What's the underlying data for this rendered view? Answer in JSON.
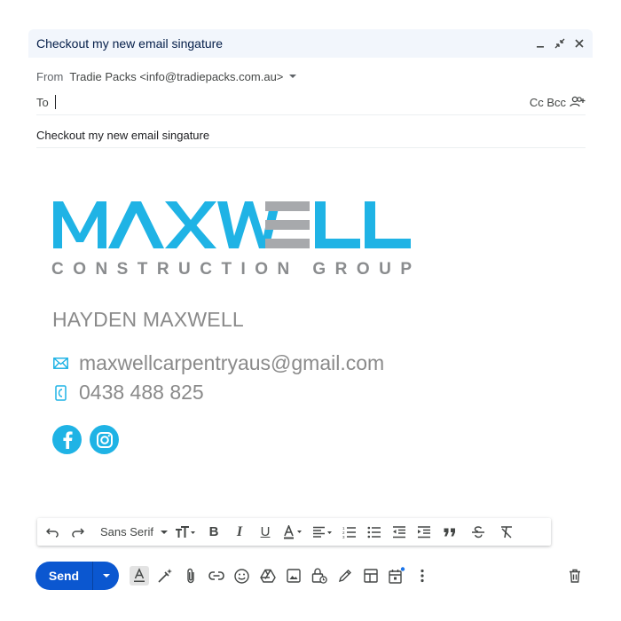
{
  "window": {
    "title": "Checkout my new email singature"
  },
  "from": {
    "label": "From",
    "value": "Tradie Packs <info@tradiepacks.com.au>"
  },
  "to": {
    "label": "To",
    "cc_bcc": "Cc Bcc"
  },
  "subject": "Checkout my new email singature",
  "signature": {
    "logo_word": "MAXWELL",
    "logo_tagline": "CONSTRUCTION GROUP",
    "name": "HAYDEN MAXWELL",
    "email": "maxwellcarpentryaus@gmail.com",
    "phone": "0438 488 825",
    "brand_color": "#1fb3e5",
    "accent_gray": "#a7a9ac",
    "socials": [
      "facebook-icon",
      "instagram-icon"
    ]
  },
  "toolbar": {
    "font": "Sans Serif",
    "items": [
      "undo-icon",
      "redo-icon",
      "font-family",
      "font-size-icon",
      "bold-icon",
      "italic-icon",
      "underline-icon",
      "text-color-icon",
      "align-icon",
      "numbered-list-icon",
      "bulleted-list-icon",
      "indent-less-icon",
      "indent-more-icon",
      "quote-icon",
      "strikethrough-icon",
      "remove-formatting-icon"
    ]
  },
  "bottom": {
    "send_label": "Send",
    "icons": [
      "formatting-icon",
      "ai-writing-icon",
      "attach-icon",
      "link-icon",
      "emoji-icon",
      "drive-icon",
      "photo-icon",
      "confidential-icon",
      "signature-icon",
      "layout-icon",
      "schedule-icon",
      "more-options-icon",
      "discard-icon"
    ]
  }
}
